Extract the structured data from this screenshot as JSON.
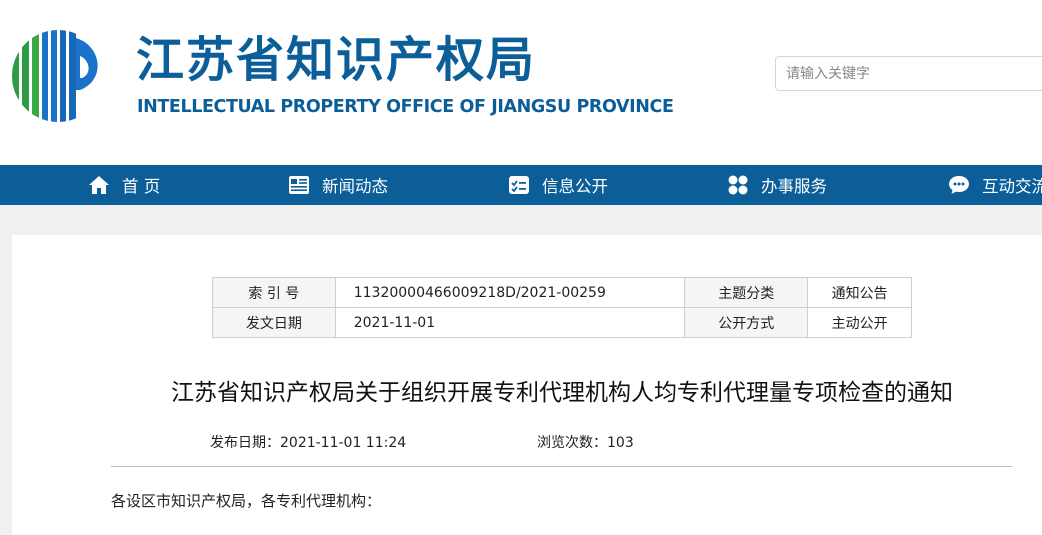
{
  "header": {
    "title": "江苏省知识产权局",
    "subtitle": "INTELLECTUAL PROPERTY OFFICE OF JIANGSU PROVINCE",
    "logo_icon": "jiangsu-ipo-logo-icon",
    "search_placeholder": "请输入关键字"
  },
  "nav": {
    "items": [
      {
        "label": "首 页",
        "icon": "home-icon"
      },
      {
        "label": "新闻动态",
        "icon": "newspaper-icon"
      },
      {
        "label": "信息公开",
        "icon": "checklist-icon"
      },
      {
        "label": "办事服务",
        "icon": "grid-icon"
      },
      {
        "label": "互动交流",
        "icon": "chat-icon"
      }
    ]
  },
  "meta": {
    "index_label": "索 引 号",
    "index_value": "11320000466009218D/2021-00259",
    "topic_label": "主题分类",
    "topic_value": "通知公告",
    "date_label": "发文日期",
    "date_value": "2021-11-01",
    "method_label": "公开方式",
    "method_value": "主动公开"
  },
  "article": {
    "title": "江苏省知识产权局关于组织开展专利代理机构人均专利代理量专项检查的通知",
    "publish_label": "发布日期：",
    "publish_value": "2021-11-01 11:24",
    "views_label": "浏览次数：",
    "views_value": "103",
    "greeting": "各设区市知识产权局，各专利代理机构："
  },
  "colors": {
    "brand_blue": "#0b5e98",
    "logo_green": "#2e9b46",
    "logo_blue": "#1a73c9"
  }
}
